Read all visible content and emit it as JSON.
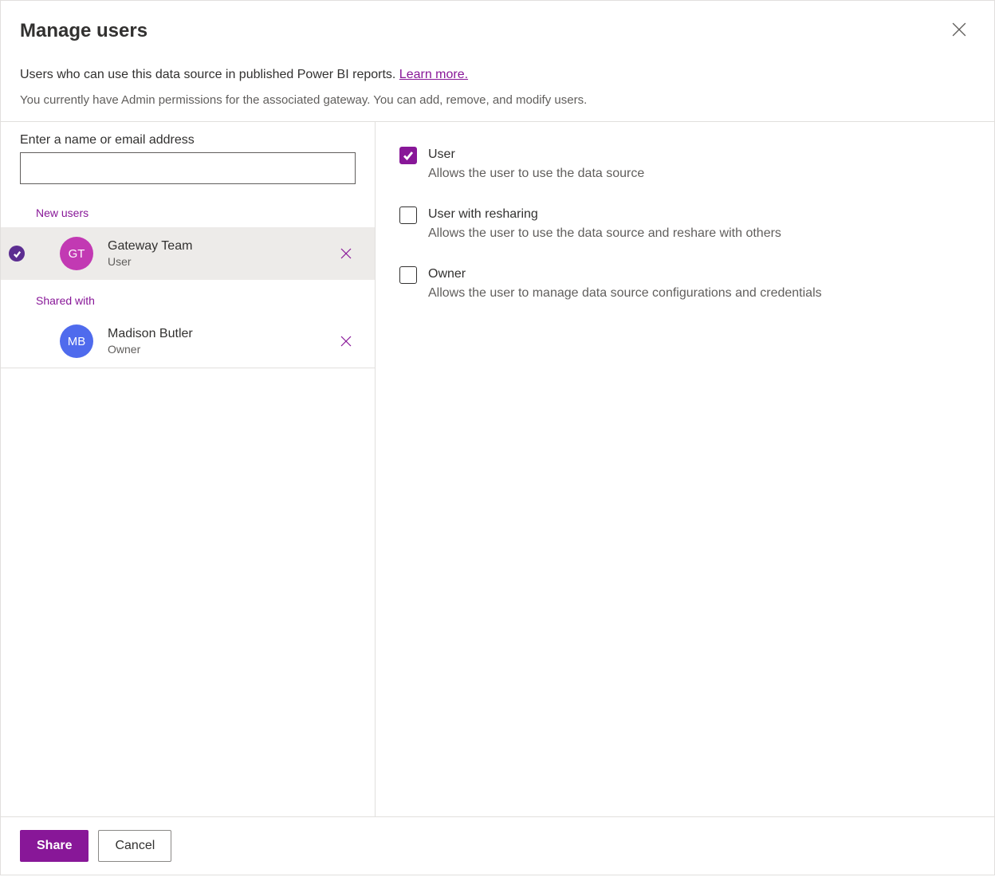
{
  "dialog": {
    "title": "Manage users",
    "description": "Users who can use this data source in published Power BI reports. ",
    "learn_more": "Learn more.",
    "subdescription": "You currently have Admin permissions for the associated gateway. You can add, remove, and modify users."
  },
  "left_panel": {
    "input_label": "Enter a name or email address",
    "input_value": "",
    "sections": {
      "new_users": {
        "label": "New users",
        "users": [
          {
            "initials": "GT",
            "name": "Gateway Team",
            "role": "User",
            "avatar_color": "magenta",
            "selected": true
          }
        ]
      },
      "shared_with": {
        "label": "Shared with",
        "users": [
          {
            "initials": "MB",
            "name": "Madison Butler",
            "role": "Owner",
            "avatar_color": "blue",
            "selected": false
          }
        ]
      }
    }
  },
  "permissions": [
    {
      "key": "user",
      "label": "User",
      "description": "Allows the user to use the data source",
      "checked": true
    },
    {
      "key": "user_resharing",
      "label": "User with resharing",
      "description": "Allows the user to use the data source and reshare with others",
      "checked": false
    },
    {
      "key": "owner",
      "label": "Owner",
      "description": "Allows the user to manage data source configurations and credentials",
      "checked": false
    }
  ],
  "footer": {
    "primary": "Share",
    "secondary": "Cancel"
  }
}
